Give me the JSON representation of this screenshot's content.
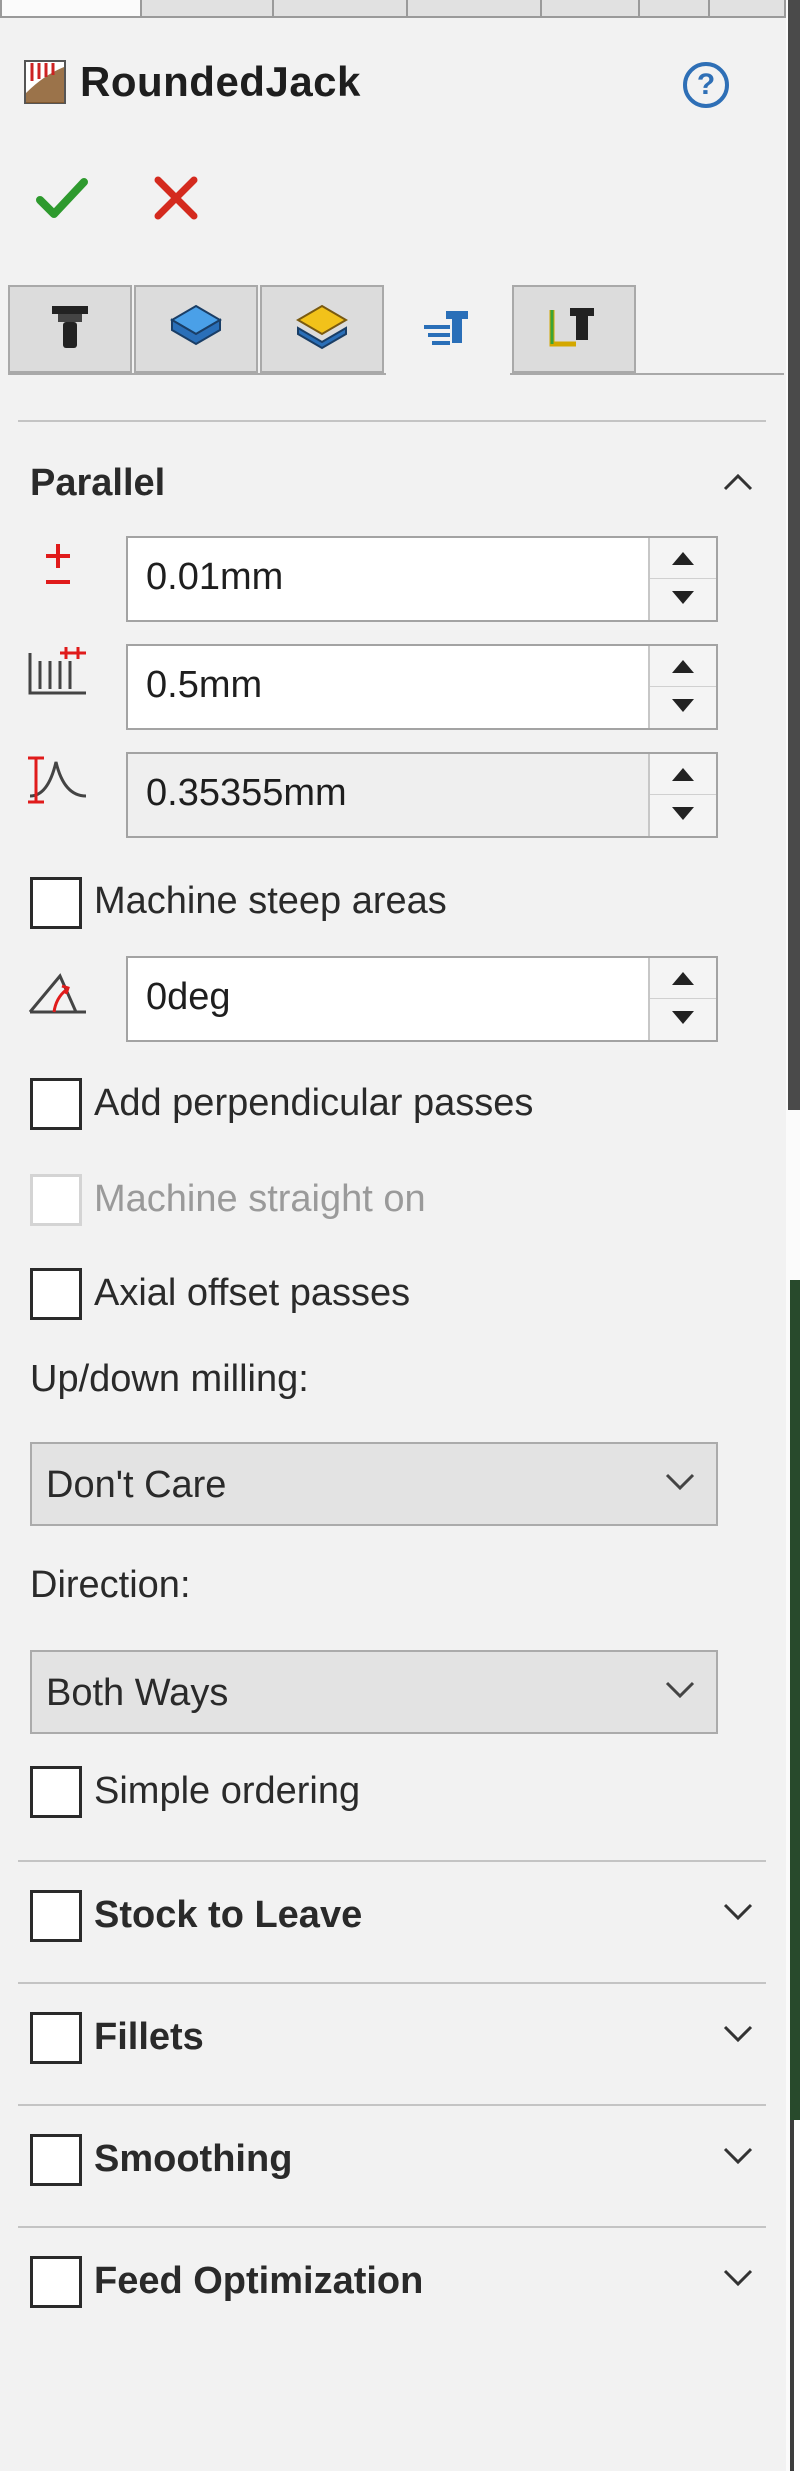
{
  "header": {
    "title": "RoundedJack"
  },
  "parallel": {
    "heading": "Parallel",
    "tolerance": "0.01mm",
    "stepover": "0.5mm",
    "cusp": "0.35355mm",
    "machine_steep_label": "Machine steep areas",
    "angle": "0deg",
    "add_perpendicular_label": "Add perpendicular passes",
    "machine_straight_label": "Machine straight on",
    "axial_offset_label": "Axial offset passes",
    "updown_label": "Up/down milling:",
    "updown_value": "Don't Care",
    "direction_label": "Direction:",
    "direction_value": "Both Ways",
    "simple_ordering_label": "Simple ordering"
  },
  "sections": {
    "stock": "Stock to Leave",
    "fillets": "Fillets",
    "smoothing": "Smoothing",
    "feed": "Feed Optimization"
  },
  "icons": {
    "doc": "toolpath-doc-icon",
    "help": "help-icon",
    "ok": "checkmark-icon",
    "cancel": "close-icon",
    "tabs": [
      "tool-icon",
      "stock-layer-icon",
      "layers-icon",
      "parameters-icon",
      "links-icon"
    ]
  },
  "colors": {
    "ok": "#2e9a2e",
    "cancel": "#d42a1e",
    "accent": "#2e6fb6",
    "tolerance_icon": "#e01b1b"
  }
}
